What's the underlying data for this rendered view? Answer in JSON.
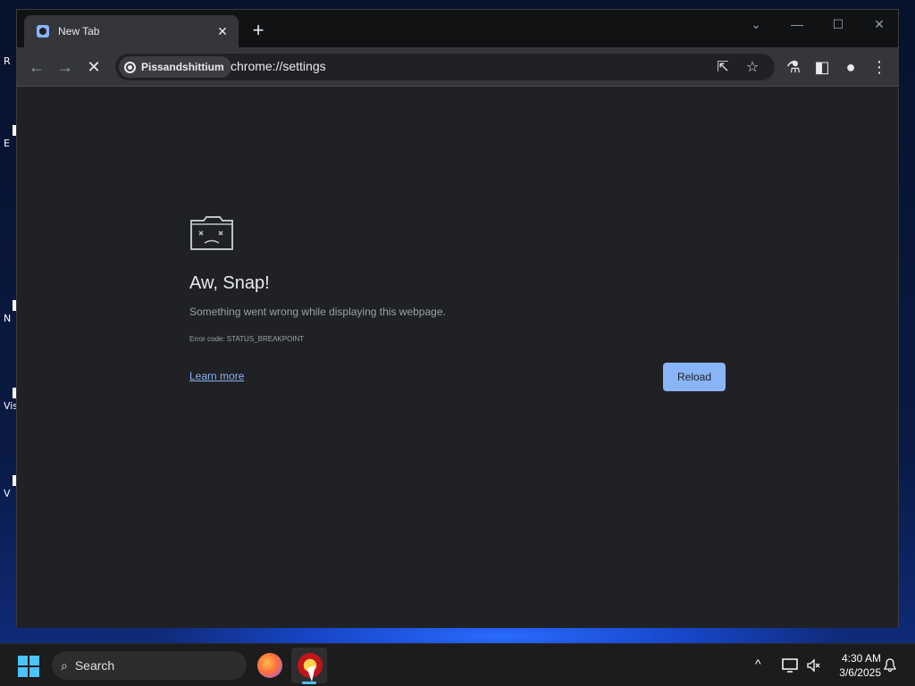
{
  "desktop": {
    "icons": [
      {
        "label": "R"
      },
      {
        "label": "E"
      },
      {
        "label": "N"
      },
      {
        "label": "Vis"
      },
      {
        "label": "V"
      }
    ]
  },
  "tabs": [
    {
      "title": "New Tab",
      "close": "✕"
    }
  ],
  "tabstrip": {
    "new_tab": "+"
  },
  "window_controls": {
    "dropdown": "⌄",
    "minimize": "—",
    "maximize": "☐",
    "close": "✕"
  },
  "toolbar": {
    "back": "←",
    "forward": "→",
    "stop": "✕",
    "site_chip": "Pissandshittium",
    "url": "chrome://settings",
    "share": "⇱",
    "bookmark": "☆",
    "labs": "⚗",
    "side_panel": "◧",
    "profile": "●",
    "menu": "⋮"
  },
  "error_page": {
    "title": "Aw, Snap!",
    "message": "Something went wrong while displaying this webpage.",
    "code": "Error code: STATUS_BREAKPOINT",
    "learn_more": "Learn more",
    "reload": "Reload"
  },
  "taskbar": {
    "search_placeholder": "Search",
    "search_icon": "⌕",
    "tray_chevron": "^",
    "time": "4:30 AM",
    "date": "3/6/2025",
    "bell": "🔔"
  },
  "colors": {
    "accent": "#8ab4f8",
    "page_bg": "#202124",
    "toolbar_bg": "#35363a",
    "windows_accent": "#4cc2ff"
  }
}
